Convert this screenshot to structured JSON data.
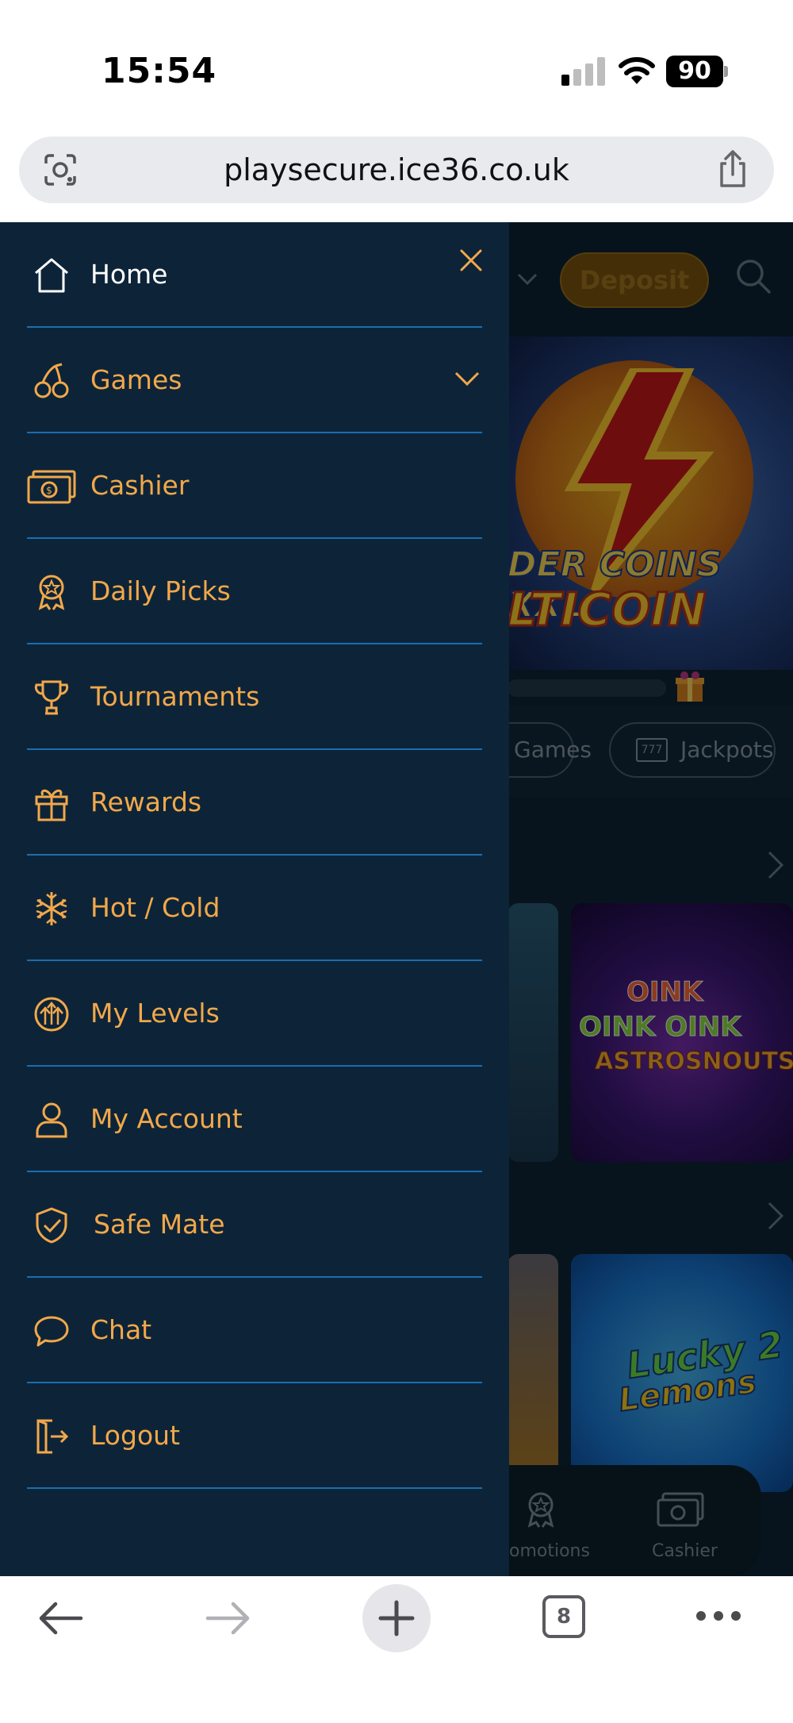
{
  "status_bar": {
    "time": "15:54",
    "battery": "90"
  },
  "browser": {
    "url": "playsecure.ice36.co.uk",
    "tab_count": "8"
  },
  "page": {
    "deposit_label": "Deposit",
    "hero_line1": "DER COINS XXL",
    "hero_line2": "LTICOIN",
    "chips": {
      "games": "Games",
      "jackpots": "Jackpots",
      "jackpots_icon_text": "777"
    },
    "tile_oink": {
      "line1": "OINK",
      "line2": "OINK OINK",
      "line3": "ASTROSNOUTS"
    },
    "tile_lemons": {
      "line1": "Lucky 2",
      "line2": "Lemons"
    },
    "bottom_nav": {
      "promotions": "omotions",
      "cashier": "Cashier"
    }
  },
  "drawer": {
    "items": [
      {
        "label": "Home",
        "icon": "home-icon"
      },
      {
        "label": "Games",
        "icon": "cherries-icon",
        "expandable": true
      },
      {
        "label": "Cashier",
        "icon": "cash-icon"
      },
      {
        "label": "Daily Picks",
        "icon": "award-badge-icon"
      },
      {
        "label": "Tournaments",
        "icon": "trophy-icon"
      },
      {
        "label": "Rewards",
        "icon": "gift-icon"
      },
      {
        "label": "Hot / Cold",
        "icon": "snowflake-icon"
      },
      {
        "label": "My Levels",
        "icon": "levels-up-icon"
      },
      {
        "label": "My Account",
        "icon": "user-icon"
      },
      {
        "label": "Safe Mate",
        "icon": "shield-check-icon"
      },
      {
        "label": "Chat",
        "icon": "chat-bubble-icon"
      },
      {
        "label": "Logout",
        "icon": "logout-icon"
      }
    ]
  },
  "colors": {
    "drawer_bg": "#0d2438",
    "accent_orange": "#f2a84a",
    "divider_blue": "#1b6db0",
    "page_bg": "#0e2535"
  }
}
